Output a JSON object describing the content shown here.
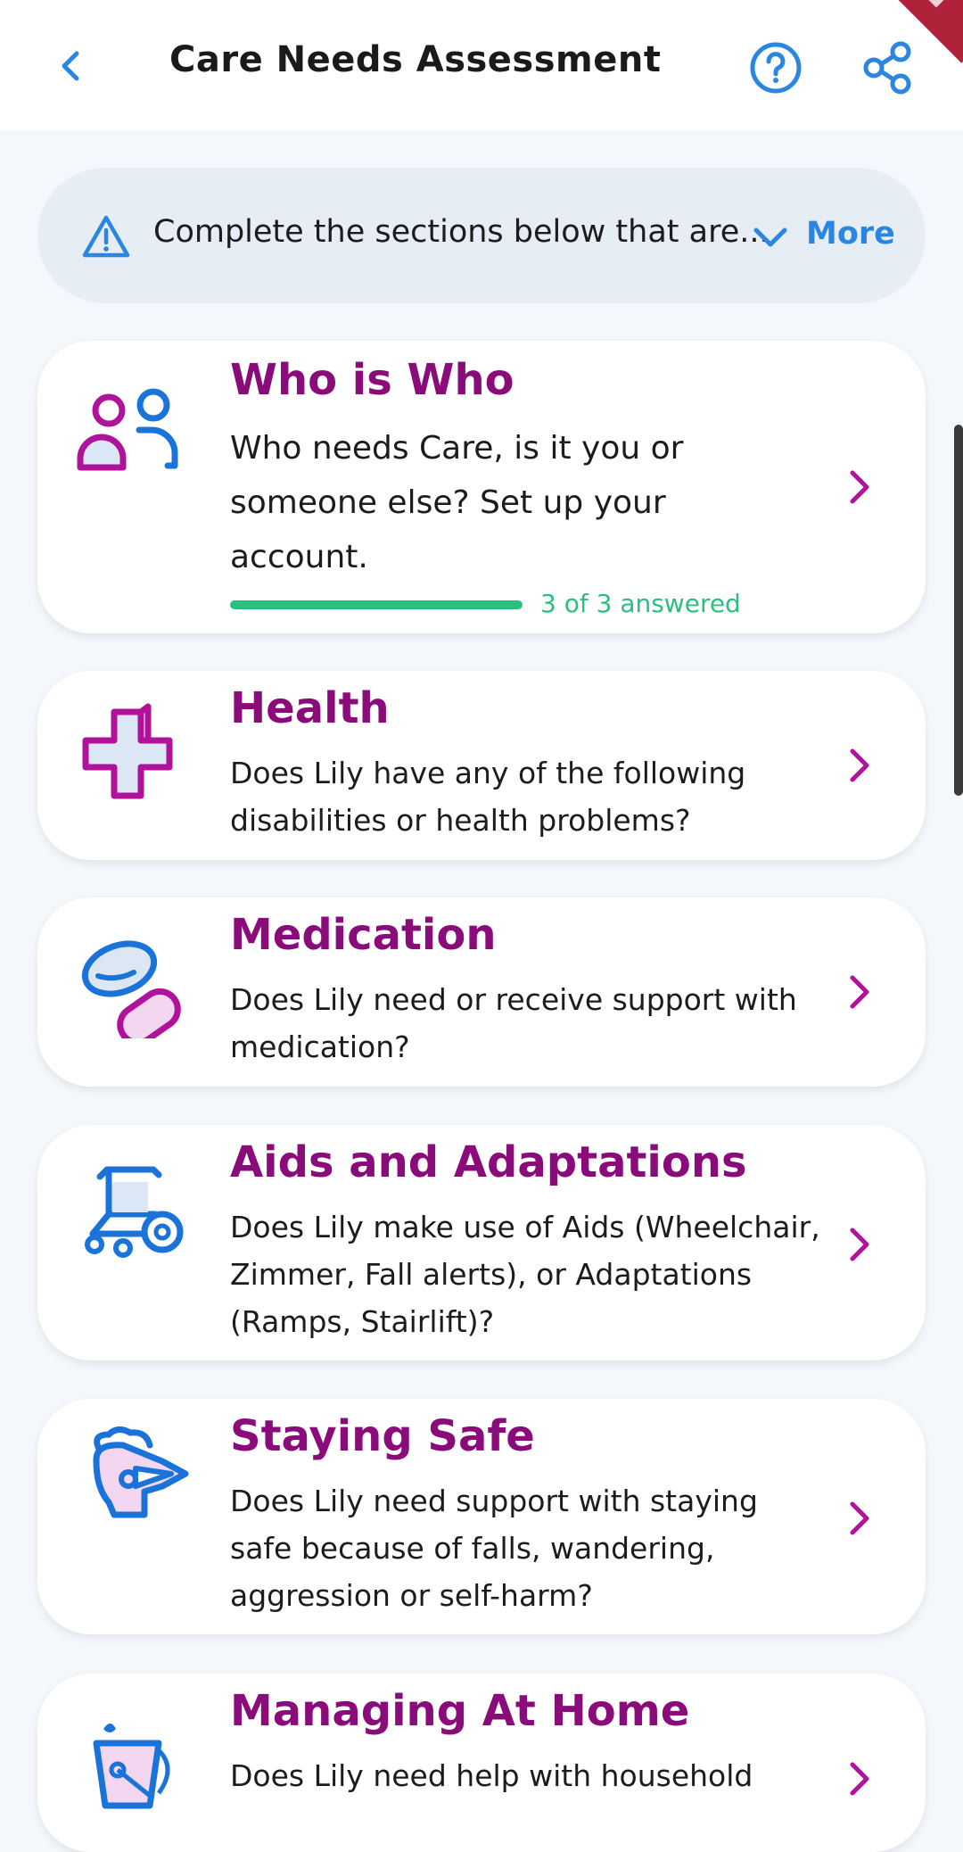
{
  "header": {
    "title": "Care Needs Assessment",
    "icons": {
      "back": "chevron-left-icon",
      "help": "help-circle-icon",
      "share": "share-icon"
    },
    "accent_color": "#2a86e0"
  },
  "banner": {
    "message": "Complete the sections below that are...",
    "more_label": "More",
    "icon": "warning-triangle-icon"
  },
  "sections": [
    {
      "title": "Who is Who",
      "description": "Who needs Care, is it you or someone else? Set up your account.",
      "icon": "people-icon",
      "progress_label": "3 of 3 answered",
      "progress_fraction": 1.0
    },
    {
      "title": "Health",
      "description": "Does Lily have any of the following disabilities or health problems?",
      "icon": "medical-cross-icon"
    },
    {
      "title": "Medication",
      "description": "Does Lily need or receive support with medication?",
      "icon": "pills-icon"
    },
    {
      "title": "Aids and Adaptations",
      "description": "Does Lily make use of Aids (Wheelchair, Zimmer, Fall alerts), or Adaptations (Ramps, Stairlift)?",
      "icon": "wheelchair-icon"
    },
    {
      "title": "Staying Safe",
      "description": "Does Lily need support with staying safe because of falls, wandering, aggression or self-harm?",
      "icon": "knight-helmet-icon"
    },
    {
      "title": "Managing At Home",
      "description": "Does Lily need help with household",
      "icon": "mop-bucket-icon"
    }
  ],
  "colors": {
    "section_title": "#8a0c7a",
    "progress": "#2bbf7f",
    "icon_blue": "#1a73d9",
    "icon_magenta": "#b0129a"
  }
}
